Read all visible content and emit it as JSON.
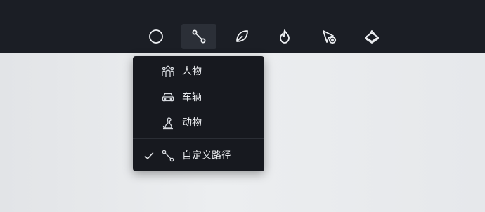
{
  "toolbar": {
    "tools": [
      {
        "icon": "circle-icon",
        "active": false
      },
      {
        "icon": "path-icon",
        "active": true
      },
      {
        "icon": "leaf-icon",
        "active": false
      },
      {
        "icon": "flame-icon",
        "active": false
      },
      {
        "icon": "cursor-plus-icon",
        "active": false
      },
      {
        "icon": "layers-icon",
        "active": false
      }
    ]
  },
  "menu": {
    "items": [
      {
        "label": "人物",
        "icon": "people-icon",
        "checked": false
      },
      {
        "label": "车辆",
        "icon": "vehicle-icon",
        "checked": false
      },
      {
        "label": "动物",
        "icon": "animal-icon",
        "checked": false
      },
      {
        "label": "自定义路径",
        "icon": "path-icon",
        "checked": true
      }
    ]
  },
  "colors": {
    "toolbar_bg": "#1b1e25",
    "menu_bg": "#17191f",
    "active_tool_bg": "#2b2f37",
    "text": "#e9ebee",
    "canvas_bg": "#e6e8eb"
  }
}
